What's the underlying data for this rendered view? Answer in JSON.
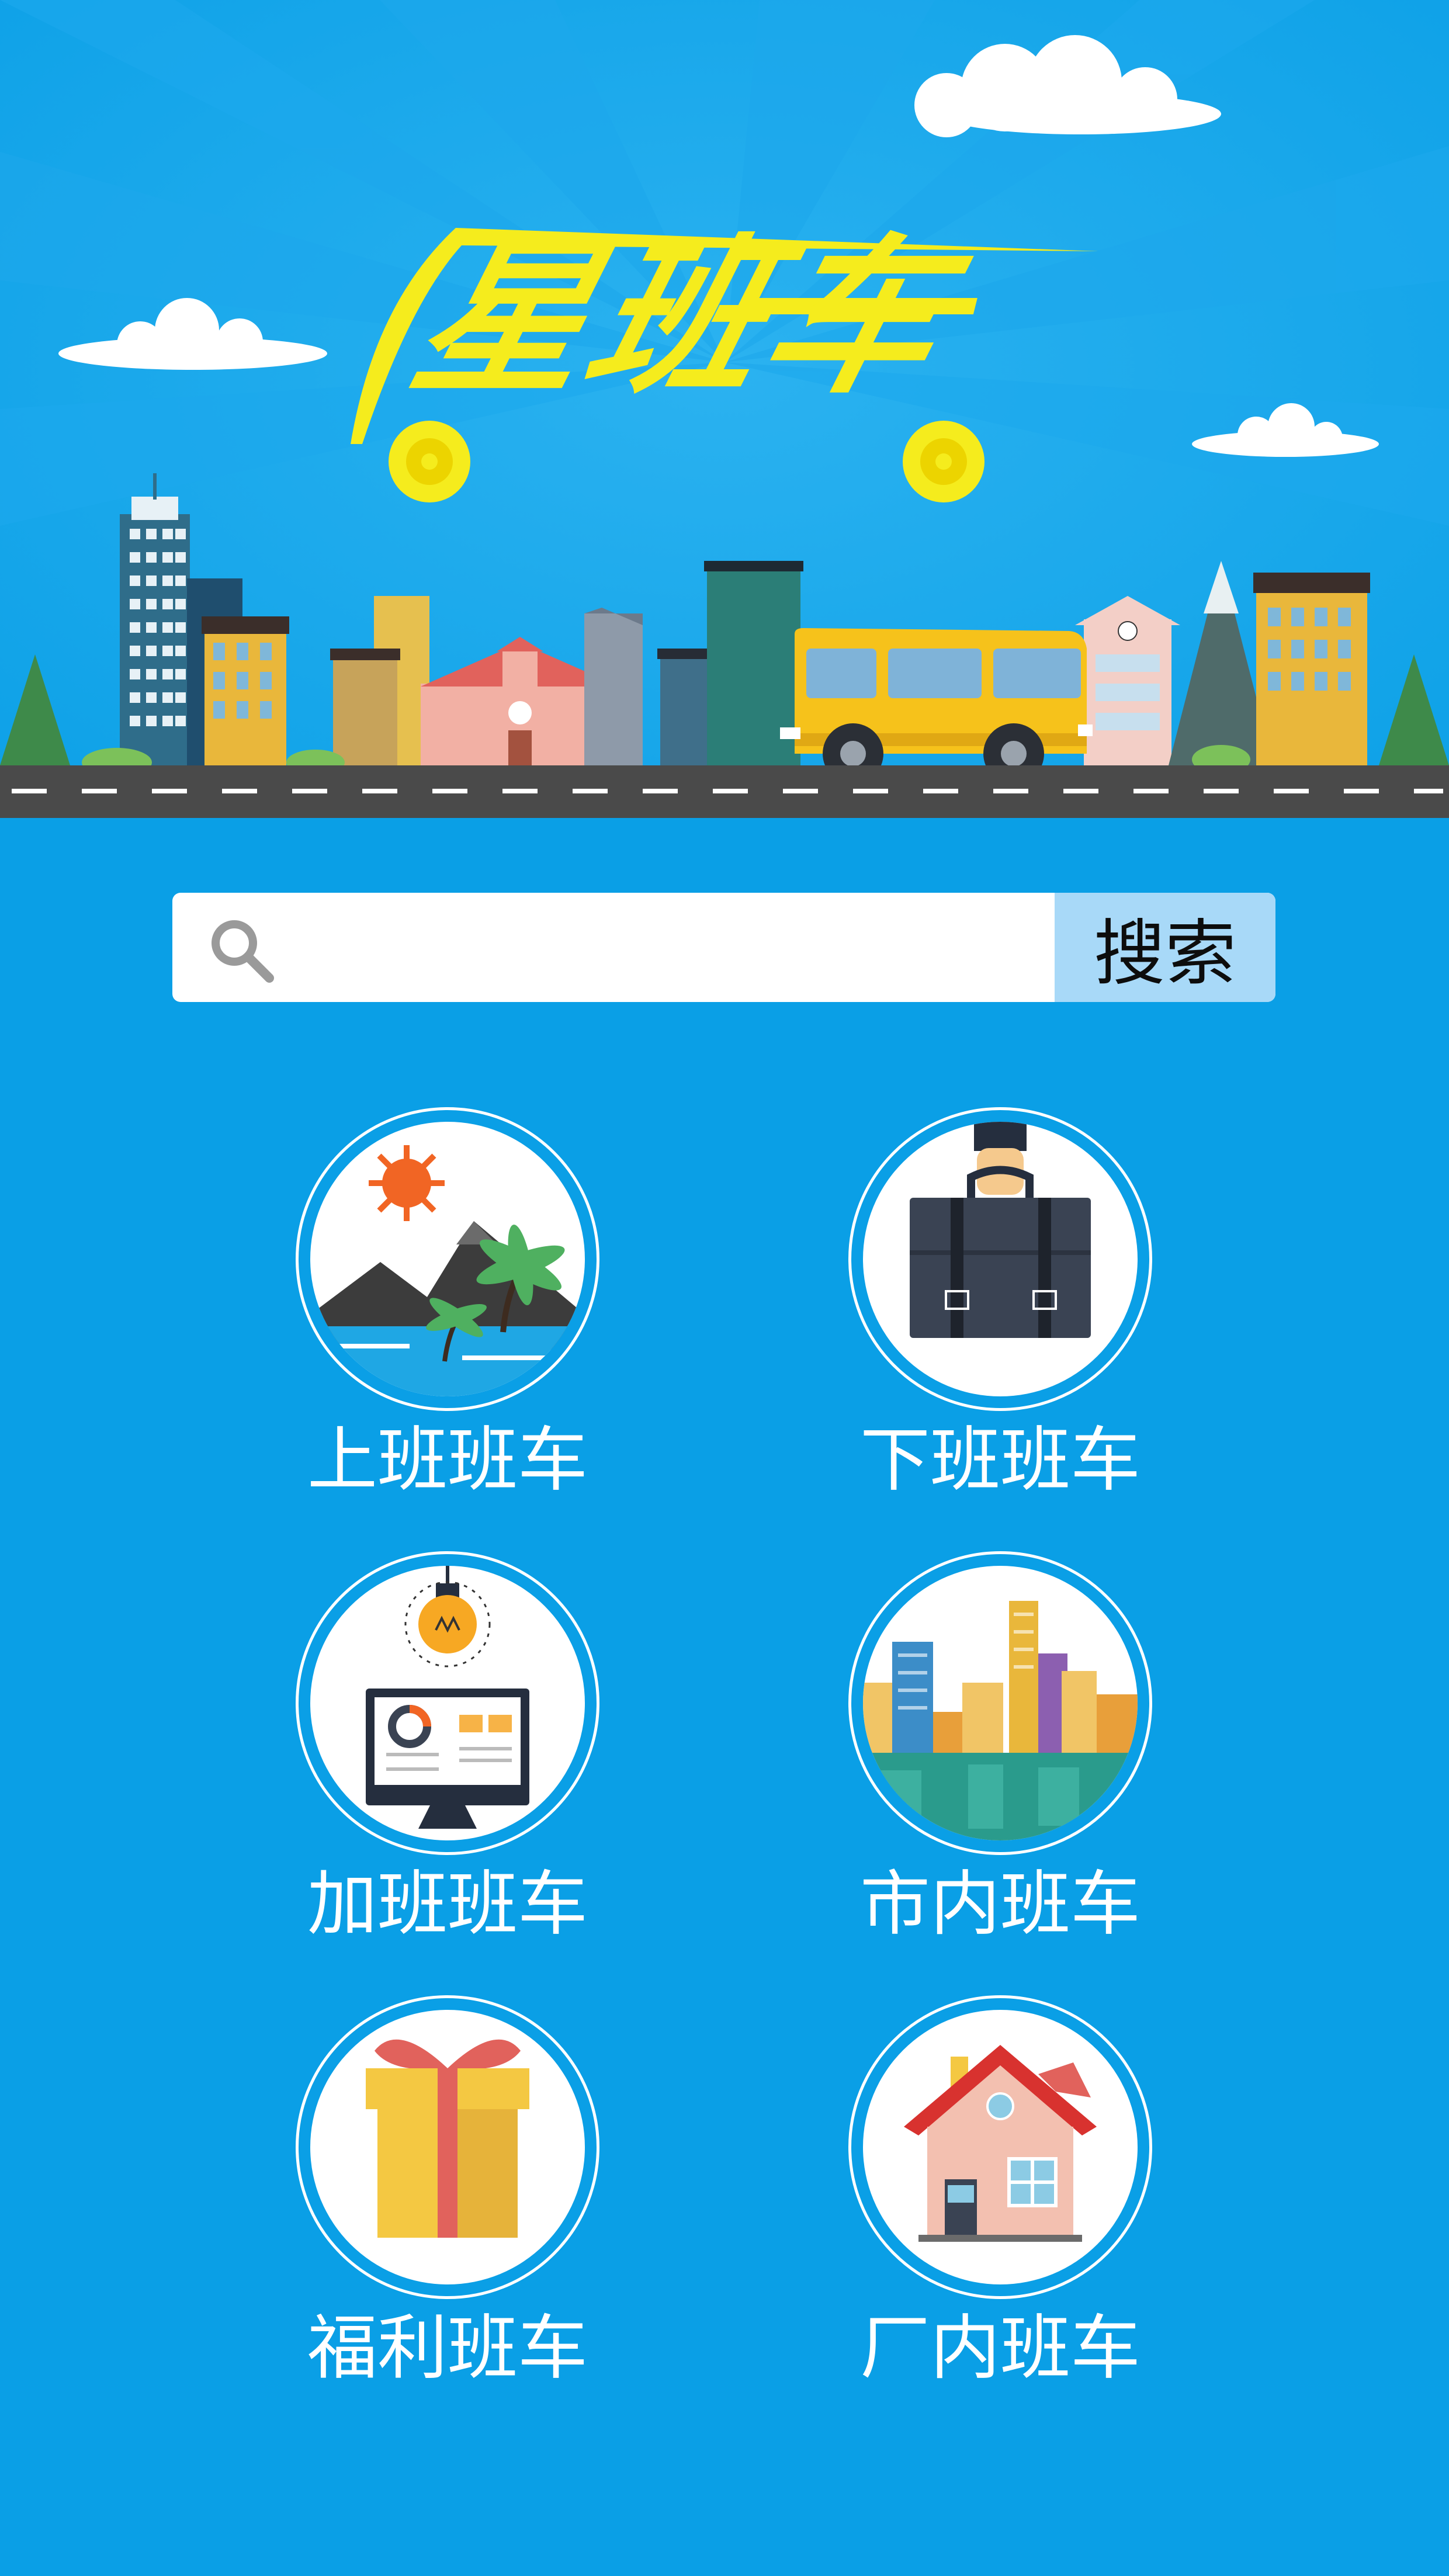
{
  "app": {
    "logo_text": "星班车"
  },
  "search": {
    "placeholder": "",
    "value": "",
    "button_label": "搜索"
  },
  "categories": [
    {
      "label": "上班班车",
      "icon": "sun-mountain-icon"
    },
    {
      "label": "下班班车",
      "icon": "briefcase-icon"
    },
    {
      "label": "加班班车",
      "icon": "lightbulb-monitor-icon"
    },
    {
      "label": "市内班车",
      "icon": "city-skyline-icon"
    },
    {
      "label": "福利班车",
      "icon": "gift-box-icon"
    },
    {
      "label": "厂内班车",
      "icon": "house-icon"
    }
  ],
  "colors": {
    "background": "#0a9fe6",
    "logo": "#f5ec1d",
    "search_button": "#a8d9f8",
    "bus": "#f6c21b",
    "road": "#4a4a4a"
  }
}
